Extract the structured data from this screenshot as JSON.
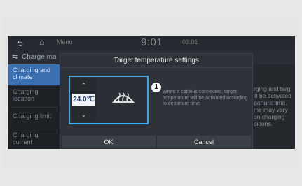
{
  "status_bar": {
    "back_icon": "back-arrow-icon",
    "home_icon": "home-icon",
    "menu_label": "Menu",
    "time": "9:01",
    "ampm": "",
    "date": "03.01"
  },
  "title_bar": {
    "icon": "charge-icon",
    "title": "Charge ma"
  },
  "sidebar": {
    "items": [
      {
        "label": "Charging and climate",
        "selected": true
      },
      {
        "label": "Charging location",
        "selected": false
      },
      {
        "label": "Charging limit",
        "selected": false
      },
      {
        "label": "Charging current",
        "selected": false
      }
    ]
  },
  "background_text": "rging and targ\nill be activated\nparture time.\nme may vary\non charging\nditions.",
  "popup": {
    "title": "Target temperature settings",
    "temperature": "24.0℃",
    "up_icon": "chevron-up-icon",
    "down_icon": "chevron-down-icon",
    "defrost_icon": "front-defrost-icon",
    "badge": "1",
    "description": "When a cable is connected, target temperature will be activated according to departure time.",
    "ok_label": "OK",
    "cancel_label": "Cancel"
  },
  "colors": {
    "selected_item": "#3a6fb0",
    "focus_border": "#3fa8e8",
    "screen_bg": "#1b1d22"
  }
}
